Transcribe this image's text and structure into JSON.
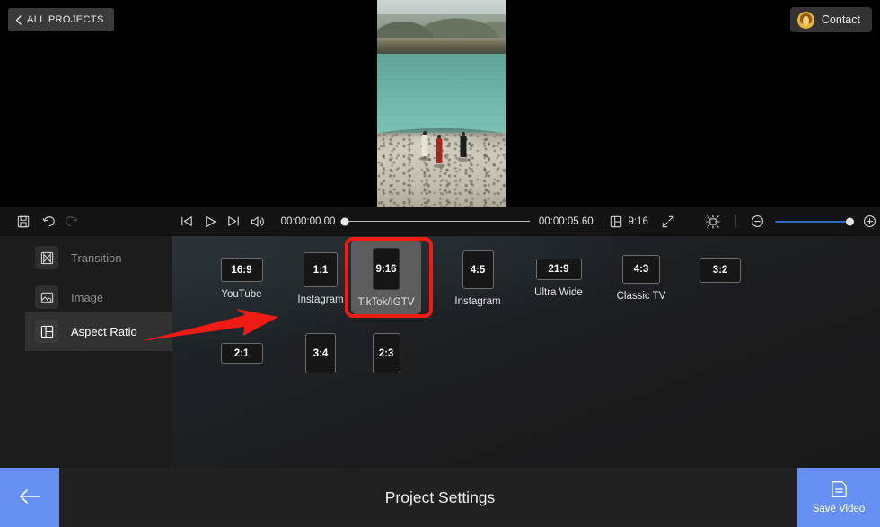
{
  "header": {
    "all_projects_label": "ALL PROJECTS",
    "back_chevron_icon": "chevron-left-icon",
    "contact_label": "Contact",
    "contact_avatar_icon": "user-avatar-icon",
    "contact_avatar_color": "#e8b33c"
  },
  "preview": {
    "description": "Vertical video preview of three people standing on a rocky shore beside a turquoise lake with hills in the background",
    "people": [
      {
        "outfit": "white",
        "color": "#e7e3da"
      },
      {
        "outfit": "red",
        "color": "#9e2a23"
      },
      {
        "outfit": "black",
        "color": "#1d1d1f"
      }
    ]
  },
  "toolbar": {
    "save_icon": "save-disk-icon",
    "undo_icon": "undo-arrow-icon",
    "redo_icon": "redo-arrow-icon",
    "redo_disabled": true,
    "skip_back_icon": "skip-to-start-icon",
    "play_icon": "play-icon",
    "skip_forward_icon": "skip-to-end-icon",
    "volume_icon": "volume-speaker-icon",
    "current_time": "00:00:00.00",
    "total_time": "00:00:05.60",
    "scrub_position_percent": 0,
    "aspect_ratio_icon": "aspect-ratio-icon",
    "aspect_ratio_value": "9:16",
    "fullscreen_icon": "fullscreen-expand-icon",
    "snap_icon": "snap-to-grid-icon",
    "zoom_out_icon": "zoom-out-icon",
    "zoom_in_icon": "zoom-in-icon",
    "zoom_slider_percent": 100,
    "zoom_slider_color": "#2b68c8"
  },
  "sidebar": {
    "items": [
      {
        "label": "Transition",
        "icon": "transition-icon",
        "selected": false
      },
      {
        "label": "Image",
        "icon": "image-icon",
        "selected": false
      },
      {
        "label": "Aspect Ratio",
        "icon": "aspect-ratio-icon",
        "selected": true
      }
    ]
  },
  "aspect_ratios": {
    "selected": "9:16",
    "selection_highlight_color": "#ee1c14",
    "items": [
      {
        "ratio": "16:9",
        "label": "YouTube",
        "selected": false
      },
      {
        "ratio": "1:1",
        "label": "Instagram",
        "selected": false
      },
      {
        "ratio": "9:16",
        "label": "TikTok/IGTV",
        "selected": true
      },
      {
        "ratio": "4:5",
        "label": "Instagram",
        "selected": false
      },
      {
        "ratio": "21:9",
        "label": "Ultra Wide",
        "selected": false
      },
      {
        "ratio": "4:3",
        "label": "Classic TV",
        "selected": false
      },
      {
        "ratio": "3:2",
        "label": "",
        "selected": false
      },
      {
        "ratio": "2:1",
        "label": "",
        "selected": false
      },
      {
        "ratio": "3:4",
        "label": "",
        "selected": false
      },
      {
        "ratio": "2:3",
        "label": "",
        "selected": false
      }
    ]
  },
  "annotation": {
    "arrow_icon": "red-pointer-arrow",
    "arrow_color": "#ee1c14"
  },
  "bottom": {
    "back_icon": "arrow-left-icon",
    "back_color": "#6690f4",
    "title": "Project Settings",
    "save_label": "Save Video",
    "save_icon": "save-document-icon",
    "save_color": "#6690f4"
  }
}
